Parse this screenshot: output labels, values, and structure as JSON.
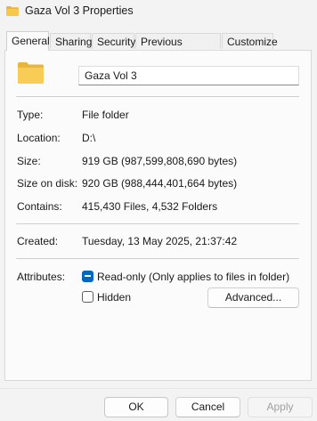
{
  "window": {
    "title": "Gaza Vol 3 Properties",
    "folder_icon_color": "#f7c948"
  },
  "tabs": [
    {
      "label": "General",
      "active": true
    },
    {
      "label": "Sharing",
      "active": false
    },
    {
      "label": "Security",
      "active": false
    },
    {
      "label": "Previous Versions",
      "active": false
    },
    {
      "label": "Customize",
      "active": false
    }
  ],
  "name_field": {
    "value": "Gaza Vol 3"
  },
  "properties": {
    "type": {
      "label": "Type:",
      "value": "File folder"
    },
    "location": {
      "label": "Location:",
      "value": "D:\\"
    },
    "size": {
      "label": "Size:",
      "value": "919 GB (987,599,808,690 bytes)"
    },
    "size_on_disk": {
      "label": "Size on disk:",
      "value": "920 GB (988,444,401,664 bytes)"
    },
    "contains": {
      "label": "Contains:",
      "value": "415,430 Files, 4,532 Folders"
    },
    "created": {
      "label": "Created:",
      "value": "Tuesday, 13 May 2025, 21:37:42"
    }
  },
  "attributes": {
    "label": "Attributes:",
    "readonly": {
      "label": "Read-only (Only applies to files in folder)",
      "state": "indeterminate"
    },
    "hidden": {
      "label": "Hidden",
      "checked": false
    },
    "advanced_button": "Advanced..."
  },
  "buttons": {
    "ok": "OK",
    "cancel": "Cancel",
    "apply": "Apply"
  },
  "colors": {
    "accent": "#0067c0"
  }
}
